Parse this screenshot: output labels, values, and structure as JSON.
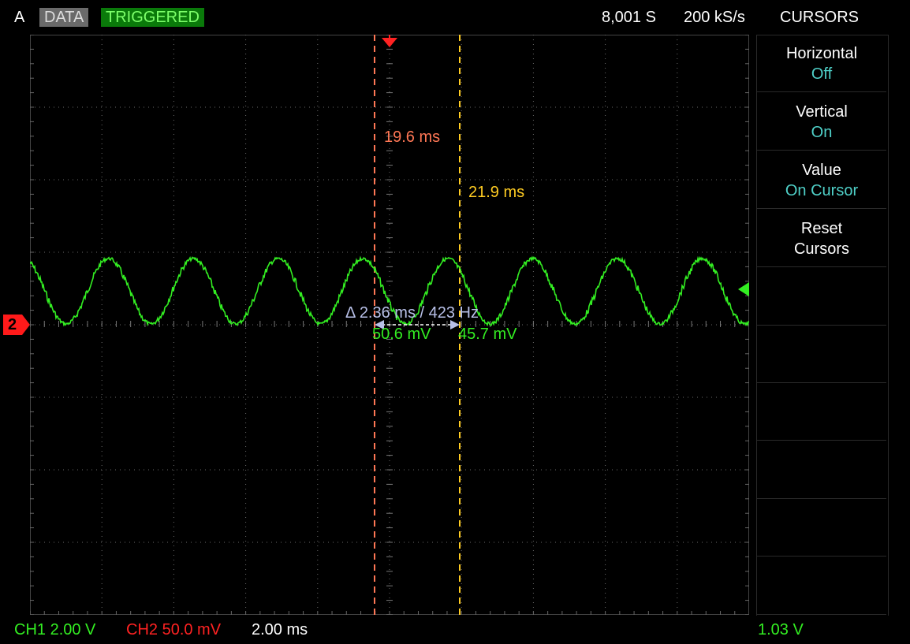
{
  "header": {
    "channel_letter": "A",
    "mode_badge": "DATA",
    "status_badge": "TRIGGERED",
    "samples": "8,001 S",
    "sample_rate": "200 kS/s",
    "menu_title": "CURSORS"
  },
  "softkeys": [
    {
      "label": "Horizontal",
      "value": "Off"
    },
    {
      "label": "Vertical",
      "value": "On"
    },
    {
      "label": "Value",
      "value": "On Cursor"
    },
    {
      "label": "Reset",
      "value": "Cursors"
    }
  ],
  "cursors": {
    "cursor1_time": "19.6 ms",
    "cursor2_time": "21.9 ms",
    "delta": "Δ 2.36 ms / 423 Hz",
    "cursor1_value": "50.6 mV",
    "cursor2_value": "45.7 mV"
  },
  "channel_marker": "2",
  "footer": {
    "ch1": "CH1 2.00 V",
    "ch2": "CH2 50.0 mV",
    "timebase": "2.00 ms",
    "trigger_level": "1.03 V"
  },
  "colors": {
    "waveform": "#33ee22",
    "ch2": "#ff2222",
    "cursor1": "#ff7755",
    "cursor2": "#ffcc22",
    "triggered_bg": "#0a7a0a",
    "data_bg": "#6a6a6a",
    "menu_value": "#4fd0c8"
  }
}
